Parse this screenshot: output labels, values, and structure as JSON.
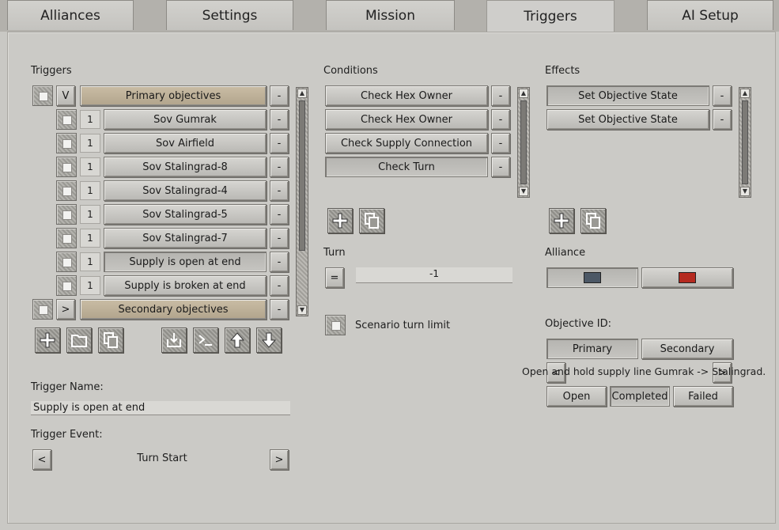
{
  "tabs": [
    "Alliances",
    "Settings",
    "Mission",
    "Triggers",
    "AI Setup"
  ],
  "active_tab": "Triggers",
  "triggers": {
    "section_label": "Triggers",
    "groups_toggle_open": "V",
    "groups_toggle_closed": ">",
    "primary_label": "Primary objectives",
    "secondary_label": "Secondary objectives",
    "items": [
      {
        "num": "1",
        "label": "Sov Gumrak"
      },
      {
        "num": "1",
        "label": "Sov Airfield"
      },
      {
        "num": "1",
        "label": "Sov Stalingrad-8"
      },
      {
        "num": "1",
        "label": "Sov Stalingrad-4"
      },
      {
        "num": "1",
        "label": "Sov Stalingrad-5"
      },
      {
        "num": "1",
        "label": "Sov Stalingrad-7"
      },
      {
        "num": "1",
        "label": "Supply is open at end"
      },
      {
        "num": "1",
        "label": "Supply is broken at end"
      }
    ],
    "remove_label": "-"
  },
  "trigger_name": {
    "label": "Trigger Name:",
    "value": "Supply is open at end"
  },
  "trigger_event": {
    "label": "Trigger Event:",
    "value": "Turn Start",
    "prev": "<",
    "next": ">"
  },
  "conditions": {
    "section_label": "Conditions",
    "items": [
      "Check Hex Owner",
      "Check Hex Owner",
      "Check Supply Connection",
      "Check Turn"
    ],
    "remove_label": "-"
  },
  "turn": {
    "label": "Turn",
    "operator": "=",
    "value": "-1"
  },
  "scenario_turn_limit": {
    "label": "Scenario turn limit"
  },
  "effects": {
    "section_label": "Effects",
    "items": [
      "Set Objective State",
      "Set Objective State"
    ],
    "remove_label": "-"
  },
  "alliance": {
    "label": "Alliance",
    "colors": [
      "#4c5866",
      "#b52a1f"
    ]
  },
  "objective": {
    "label": "Objective ID:",
    "types": [
      "Primary",
      "Secondary"
    ],
    "description": "Open and hold supply line Gumrak -> Stalingrad.",
    "prev": "<",
    "next": ">",
    "states": [
      "Open",
      "Completed",
      "Failed"
    ]
  }
}
